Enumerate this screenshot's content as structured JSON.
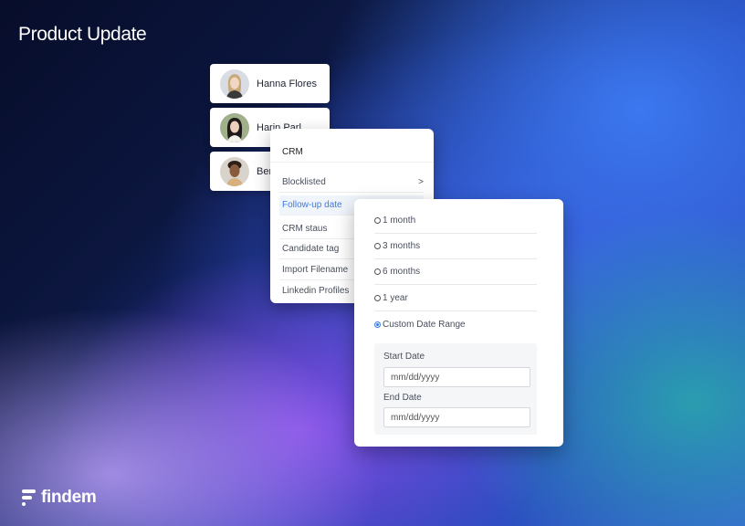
{
  "headline": "Product Update",
  "brand": {
    "name": "findem"
  },
  "people": [
    {
      "name": "Hanna Flores",
      "avatar": "avatar-woman-blonde"
    },
    {
      "name": "Harin Parl",
      "avatar": "avatar-woman-dark-hair"
    },
    {
      "name": "Ber",
      "avatar": "avatar-man-curly-hair"
    }
  ],
  "menu": {
    "title": "CRM",
    "items": [
      {
        "label": "Blocklisted",
        "arrow": ">"
      },
      {
        "label": "Follow-up date",
        "active": true
      },
      {
        "label": "CRM staus"
      },
      {
        "label": "Candidate tag"
      },
      {
        "label": "Import Filename"
      },
      {
        "label": "Linkedin Profiles"
      }
    ]
  },
  "followup": {
    "options": [
      {
        "label": "1 month",
        "selected": false
      },
      {
        "label": "3 months",
        "selected": false
      },
      {
        "label": "6 months",
        "selected": false
      },
      {
        "label": "1 year",
        "selected": false
      },
      {
        "label": "Custom Date Range",
        "selected": true
      }
    ],
    "start_label": "Start Date",
    "start_placeholder": "mm/dd/yyyy",
    "end_label": "End Date",
    "end_placeholder": "mm/dd/yyyy"
  },
  "colors": {
    "accent": "#3c7be0",
    "card": "#ffffff"
  }
}
